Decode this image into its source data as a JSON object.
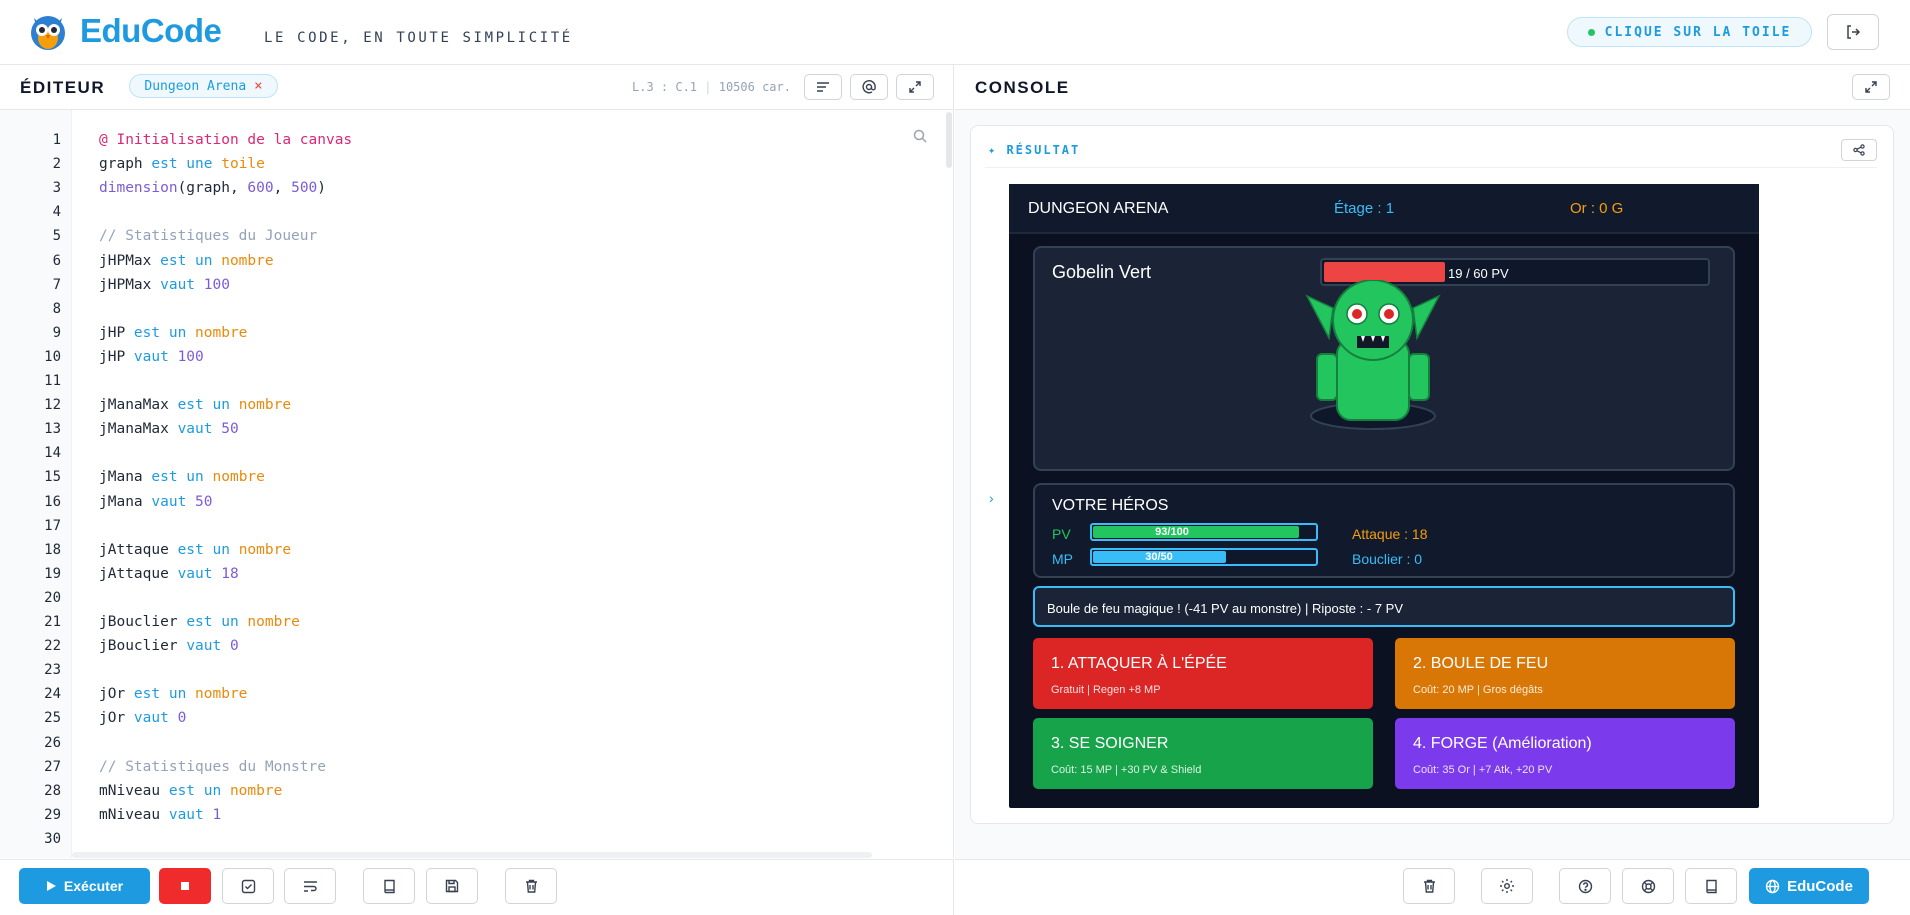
{
  "header": {
    "brand": "EduCode",
    "tagline": "LE CODE, EN TOUTE SIMPLICITÉ",
    "hint": "CLIQUE SUR LA TOILE"
  },
  "editor": {
    "title": "ÉDITEUR",
    "file_name": "Dungeon Arena",
    "cursor": "L.3 : C.1",
    "chars": "10506 car.",
    "lines": [
      {
        "n": "1"
      },
      {
        "n": "2"
      },
      {
        "n": "3"
      },
      {
        "n": "4"
      },
      {
        "n": "5"
      },
      {
        "n": "6"
      },
      {
        "n": "7"
      },
      {
        "n": "8"
      },
      {
        "n": "9"
      },
      {
        "n": "10"
      },
      {
        "n": "11"
      },
      {
        "n": "12"
      },
      {
        "n": "13"
      },
      {
        "n": "14"
      },
      {
        "n": "15"
      },
      {
        "n": "16"
      },
      {
        "n": "17"
      },
      {
        "n": "18"
      },
      {
        "n": "19"
      },
      {
        "n": "20"
      },
      {
        "n": "21"
      },
      {
        "n": "22"
      },
      {
        "n": "23"
      },
      {
        "n": "24"
      },
      {
        "n": "25"
      },
      {
        "n": "26"
      },
      {
        "n": "27"
      },
      {
        "n": "28"
      },
      {
        "n": "29"
      },
      {
        "n": "30"
      }
    ],
    "code": [
      [
        {
          "t": "@ Initialisation de la canvas",
          "c": "an"
        }
      ],
      [
        {
          "t": "graph "
        },
        {
          "t": "est une ",
          "c": "kw"
        },
        {
          "t": "toile",
          "c": "ty"
        }
      ],
      [
        {
          "t": "dimension",
          "c": "fn"
        },
        {
          "t": "(graph, "
        },
        {
          "t": "600",
          "c": "nu"
        },
        {
          "t": ", "
        },
        {
          "t": "500",
          "c": "nu"
        },
        {
          "t": ")"
        }
      ],
      [],
      [
        {
          "t": "// Statistiques du Joueur",
          "c": "cm"
        }
      ],
      [
        {
          "t": "jHPMax "
        },
        {
          "t": "est un ",
          "c": "kw"
        },
        {
          "t": "nombre",
          "c": "ty"
        }
      ],
      [
        {
          "t": "jHPMax "
        },
        {
          "t": "vaut ",
          "c": "kw"
        },
        {
          "t": "100",
          "c": "nu"
        }
      ],
      [],
      [
        {
          "t": "jHP "
        },
        {
          "t": "est un ",
          "c": "kw"
        },
        {
          "t": "nombre",
          "c": "ty"
        }
      ],
      [
        {
          "t": "jHP "
        },
        {
          "t": "vaut ",
          "c": "kw"
        },
        {
          "t": "100",
          "c": "nu"
        }
      ],
      [],
      [
        {
          "t": "jManaMax "
        },
        {
          "t": "est un ",
          "c": "kw"
        },
        {
          "t": "nombre",
          "c": "ty"
        }
      ],
      [
        {
          "t": "jManaMax "
        },
        {
          "t": "vaut ",
          "c": "kw"
        },
        {
          "t": "50",
          "c": "nu"
        }
      ],
      [],
      [
        {
          "t": "jMana "
        },
        {
          "t": "est un ",
          "c": "kw"
        },
        {
          "t": "nombre",
          "c": "ty"
        }
      ],
      [
        {
          "t": "jMana "
        },
        {
          "t": "vaut ",
          "c": "kw"
        },
        {
          "t": "50",
          "c": "nu"
        }
      ],
      [],
      [
        {
          "t": "jAttaque "
        },
        {
          "t": "est un ",
          "c": "kw"
        },
        {
          "t": "nombre",
          "c": "ty"
        }
      ],
      [
        {
          "t": "jAttaque "
        },
        {
          "t": "vaut ",
          "c": "kw"
        },
        {
          "t": "18",
          "c": "nu"
        }
      ],
      [],
      [
        {
          "t": "jBouclier "
        },
        {
          "t": "est un ",
          "c": "kw"
        },
        {
          "t": "nombre",
          "c": "ty"
        }
      ],
      [
        {
          "t": "jBouclier "
        },
        {
          "t": "vaut ",
          "c": "kw"
        },
        {
          "t": "0",
          "c": "nu"
        }
      ],
      [],
      [
        {
          "t": "jOr "
        },
        {
          "t": "est un ",
          "c": "kw"
        },
        {
          "t": "nombre",
          "c": "ty"
        }
      ],
      [
        {
          "t": "jOr "
        },
        {
          "t": "vaut ",
          "c": "kw"
        },
        {
          "t": "0",
          "c": "nu"
        }
      ],
      [],
      [
        {
          "t": "// Statistiques du Monstre",
          "c": "cm"
        }
      ],
      [
        {
          "t": "mNiveau "
        },
        {
          "t": "est un ",
          "c": "kw"
        },
        {
          "t": "nombre",
          "c": "ty"
        }
      ],
      [
        {
          "t": "mNiveau "
        },
        {
          "t": "vaut ",
          "c": "kw"
        },
        {
          "t": "1",
          "c": "nu"
        }
      ],
      []
    ],
    "run_label": "Exécuter"
  },
  "console": {
    "title": "CONSOLE",
    "result_label": "✦ RÉSULTAT"
  },
  "game": {
    "title": "DUNGEON ARENA",
    "stage": "Étage : 1",
    "gold": "Or : 0 G",
    "monster": {
      "name": "Gobelin Vert",
      "hp_text": "19 / 60 PV",
      "hp_fraction": 0.317
    },
    "hero": {
      "title": "VOTRE HÉROS",
      "pv_label": "PV",
      "pv_text": "93/100",
      "pv_fraction": 0.93,
      "mp_label": "MP",
      "mp_text": "30/50",
      "mp_fraction": 0.6,
      "attack": "Attaque : 18",
      "shield": "Bouclier : 0"
    },
    "log": "Boule de feu magique ! (-41 PV au monstre) | Riposte : - 7 PV",
    "actions": [
      {
        "title": "1. ATTAQUER À L'ÉPÉE",
        "sub": "Gratuit | Regen +8 MP",
        "color": "#dc2626"
      },
      {
        "title": "2. BOULE DE FEU",
        "sub": "Coût: 20 MP | Gros dégâts",
        "color": "#d97706"
      },
      {
        "title": "3. SE SOIGNER",
        "sub": "Coût: 15 MP | +30 PV & Shield",
        "color": "#16a34a"
      },
      {
        "title": "4. FORGE (Amélioration)",
        "sub": "Coût: 35 Or | +7 Atk, +20 PV",
        "color": "#7c3aed"
      }
    ]
  },
  "footer": {
    "educode_label": "EduCode"
  },
  "colors": {
    "accent": "#1e9be0",
    "danger": "#ef2b2b"
  }
}
